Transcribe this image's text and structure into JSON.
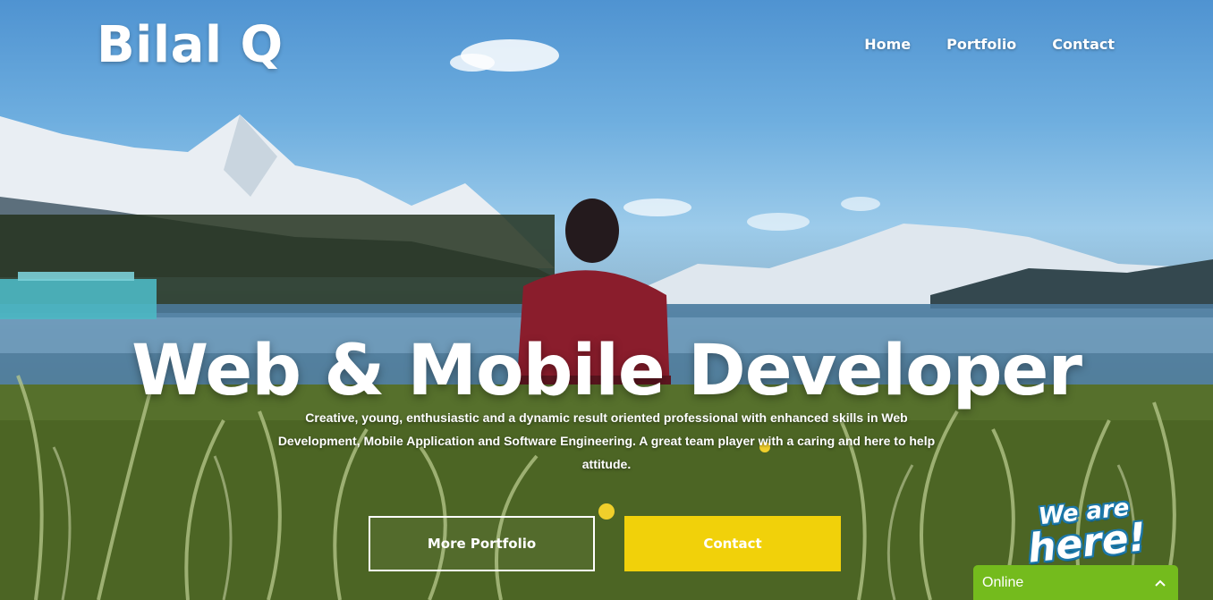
{
  "header": {
    "brand": "Bilal Q",
    "nav": [
      {
        "label": "Home"
      },
      {
        "label": "Portfolio"
      },
      {
        "label": "Contact"
      }
    ]
  },
  "hero": {
    "headline": "Web & Mobile Developer",
    "description": "Creative, young, enthusiastic and a dynamic result oriented professional with enhanced skills in Web Development, Mobile Application and Software Engineering. A great team player with a caring and here to help attitude.",
    "buttons": {
      "primary_label": "More Portfolio",
      "secondary_label": "Contact"
    }
  },
  "chat_widget": {
    "badge_line1": "We are",
    "badge_line2": "here!",
    "status": "Online",
    "chevron_icon": "chevron-up-icon",
    "color": "#74bb1d"
  },
  "colors": {
    "accent_button": "#f1d10a",
    "text": "#ffffff"
  }
}
